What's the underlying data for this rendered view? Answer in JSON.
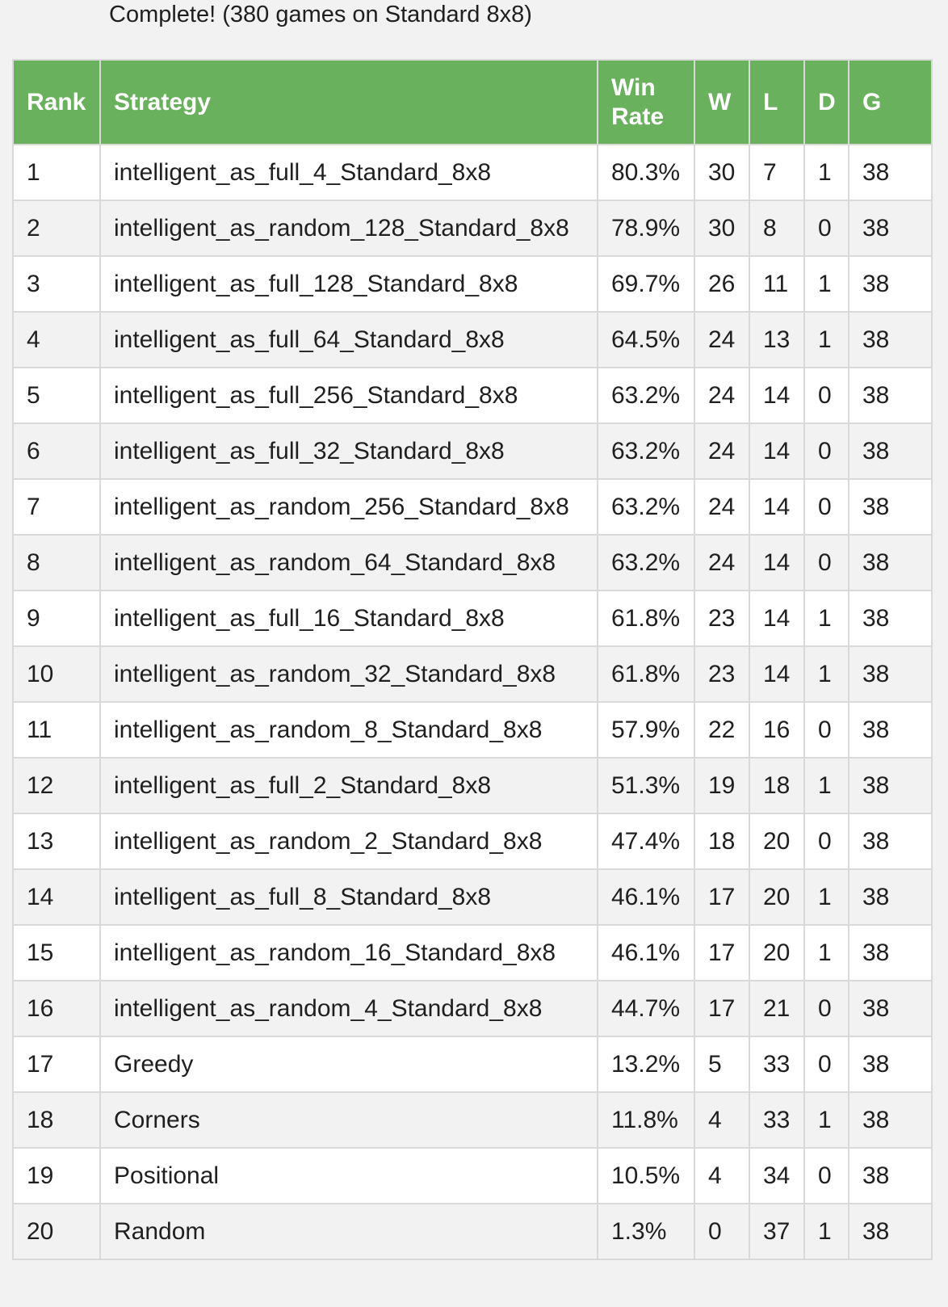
{
  "status": "Complete! (380 games on Standard 8x8)",
  "table": {
    "headers": [
      "Rank",
      "Strategy",
      "Win Rate",
      "W",
      "L",
      "D",
      "G"
    ],
    "rows": [
      [
        "1",
        "intelligent_as_full_4_Standard_8x8",
        "80.3%",
        "30",
        "7",
        "1",
        "38"
      ],
      [
        "2",
        "intelligent_as_random_128_Standard_8x8",
        "78.9%",
        "30",
        "8",
        "0",
        "38"
      ],
      [
        "3",
        "intelligent_as_full_128_Standard_8x8",
        "69.7%",
        "26",
        "11",
        "1",
        "38"
      ],
      [
        "4",
        "intelligent_as_full_64_Standard_8x8",
        "64.5%",
        "24",
        "13",
        "1",
        "38"
      ],
      [
        "5",
        "intelligent_as_full_256_Standard_8x8",
        "63.2%",
        "24",
        "14",
        "0",
        "38"
      ],
      [
        "6",
        "intelligent_as_full_32_Standard_8x8",
        "63.2%",
        "24",
        "14",
        "0",
        "38"
      ],
      [
        "7",
        "intelligent_as_random_256_Standard_8x8",
        "63.2%",
        "24",
        "14",
        "0",
        "38"
      ],
      [
        "8",
        "intelligent_as_random_64_Standard_8x8",
        "63.2%",
        "24",
        "14",
        "0",
        "38"
      ],
      [
        "9",
        "intelligent_as_full_16_Standard_8x8",
        "61.8%",
        "23",
        "14",
        "1",
        "38"
      ],
      [
        "10",
        "intelligent_as_random_32_Standard_8x8",
        "61.8%",
        "23",
        "14",
        "1",
        "38"
      ],
      [
        "11",
        "intelligent_as_random_8_Standard_8x8",
        "57.9%",
        "22",
        "16",
        "0",
        "38"
      ],
      [
        "12",
        "intelligent_as_full_2_Standard_8x8",
        "51.3%",
        "19",
        "18",
        "1",
        "38"
      ],
      [
        "13",
        "intelligent_as_random_2_Standard_8x8",
        "47.4%",
        "18",
        "20",
        "0",
        "38"
      ],
      [
        "14",
        "intelligent_as_full_8_Standard_8x8",
        "46.1%",
        "17",
        "20",
        "1",
        "38"
      ],
      [
        "15",
        "intelligent_as_random_16_Standard_8x8",
        "46.1%",
        "17",
        "20",
        "1",
        "38"
      ],
      [
        "16",
        "intelligent_as_random_4_Standard_8x8",
        "44.7%",
        "17",
        "21",
        "0",
        "38"
      ],
      [
        "17",
        "Greedy",
        "13.2%",
        "5",
        "33",
        "0",
        "38"
      ],
      [
        "18",
        "Corners",
        "11.8%",
        "4",
        "33",
        "1",
        "38"
      ],
      [
        "19",
        "Positional",
        "10.5%",
        "4",
        "34",
        "0",
        "38"
      ],
      [
        "20",
        "Random",
        "1.3%",
        "0",
        "37",
        "1",
        "38"
      ]
    ]
  }
}
